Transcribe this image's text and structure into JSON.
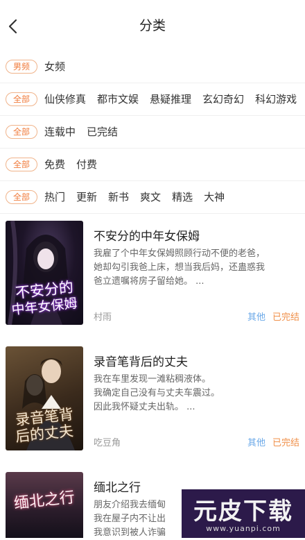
{
  "header": {
    "title": "分类",
    "back_icon": "chevron-left-icon"
  },
  "filters": {
    "channel": {
      "pill": "男频",
      "options": [
        "女频"
      ]
    },
    "genre": {
      "pill": "全部",
      "options": [
        "仙侠修真",
        "都市文娱",
        "悬疑推理",
        "玄幻奇幻",
        "科幻游戏"
      ]
    },
    "status": {
      "pill": "全部",
      "options": [
        "连载中",
        "已完结"
      ]
    },
    "price": {
      "pill": "全部",
      "options": [
        "免费",
        "付费"
      ]
    },
    "sort": {
      "pill": "全部",
      "options": [
        "热门",
        "更新",
        "新书",
        "爽文",
        "精选",
        "大神"
      ]
    }
  },
  "books": [
    {
      "title": "不安分的中年女保姆",
      "cover_text": [
        "不安分的",
        "中年女保姆"
      ],
      "desc": [
        "我雇了个中年女保姆照顾行动不便的老爸，",
        "她却勾引我爸上床，想当我后妈，还蛊惑我",
        "爸立遗嘱将房子留给她。 ..."
      ],
      "author": "村雨",
      "genre": "其他",
      "status": "已完结"
    },
    {
      "title": "录音笔背后的丈夫",
      "cover_text": [
        "录音笔背",
        "后的丈夫"
      ],
      "desc": [
        "我在车里发现一滩粘稠液体。",
        "我确定自己没有与丈夫车震过。",
        "因此我怀疑丈夫出轨。 ..."
      ],
      "author": "吃豆角",
      "genre": "其他",
      "status": "已完结"
    },
    {
      "title": "缅北之行",
      "cover_text": [
        "缅北之行"
      ],
      "desc": [
        "朋友介绍我去缅甸",
        "我在屋子内不让出",
        "我意识到被人诈骗"
      ],
      "author": "",
      "genre": "",
      "status": ""
    }
  ],
  "watermark": {
    "logo": "元皮下载",
    "url": "www.yuanpi.com"
  },
  "colors": {
    "accent": "#f07a3a",
    "genre_blue": "#6aa8e8",
    "status_orange": "#f0904a"
  }
}
